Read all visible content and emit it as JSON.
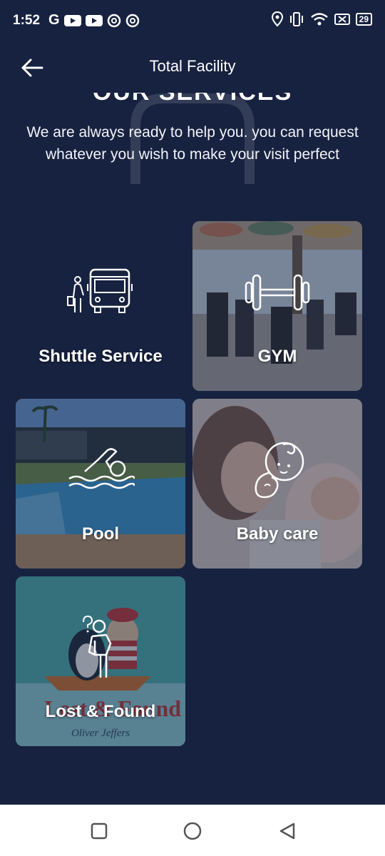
{
  "status_bar": {
    "time": "1:52",
    "left_icons": [
      "google-g-icon",
      "youtube-icon",
      "youtube-icon",
      "at-sign-icon",
      "at-sign-icon"
    ],
    "right_icons": [
      "location-icon",
      "vibrate-icon",
      "wifi-icon",
      "no-sim-icon"
    ],
    "battery": "29"
  },
  "app_bar": {
    "title": "Total Facility"
  },
  "intro": {
    "heading": "OUR SERVICES",
    "subtitle": "We are always ready to help you. you can request whatever you wish to make your visit perfect"
  },
  "services": [
    {
      "label": "Shuttle Service",
      "icon": "shuttle-bus-icon"
    },
    {
      "label": "GYM",
      "icon": "dumbbell-icon"
    },
    {
      "label": "Pool",
      "icon": "swimmer-icon"
    },
    {
      "label": "Baby care",
      "icon": "baby-icon"
    },
    {
      "label": "Lost & Found",
      "icon": "person-question-icon",
      "image_caption": "Oliver Jeffers"
    }
  ],
  "colors": {
    "background": "#172240",
    "nav_bar": "#ffffff",
    "nav_icon": "#555555"
  },
  "nav_bar": {
    "buttons": [
      "recents-square-icon",
      "home-circle-icon",
      "back-triangle-icon"
    ]
  }
}
